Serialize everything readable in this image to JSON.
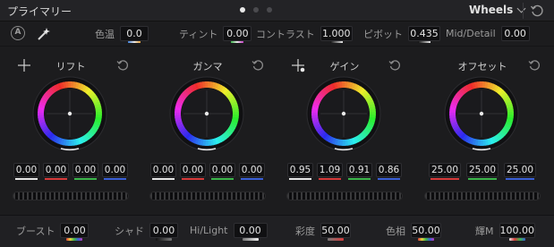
{
  "header": {
    "title": "プライマリー",
    "mode": "Wheels",
    "page_dots": 3,
    "active_dot": 0
  },
  "toolbar": {
    "auto_icon_letter": "A",
    "params": [
      {
        "label": "色温",
        "value": "0.0"
      },
      {
        "label": "ティント",
        "value": "0.00"
      },
      {
        "label": "コントラスト",
        "value": "1.000"
      },
      {
        "label": "ピボット",
        "value": "0.435"
      },
      {
        "label": "Mid/Detail",
        "value": "0.00"
      }
    ]
  },
  "wheels": [
    {
      "name": "リフト",
      "values": [
        "0.00",
        "0.00",
        "0.00",
        "0.00"
      ]
    },
    {
      "name": "ガンマ",
      "values": [
        "0.00",
        "0.00",
        "0.00",
        "0.00"
      ]
    },
    {
      "name": "ゲイン",
      "values": [
        "0.95",
        "1.09",
        "0.91",
        "0.86"
      ]
    },
    {
      "name": "オフセット",
      "values": [
        "25.00",
        "25.00",
        "25.00"
      ]
    }
  ],
  "footer": {
    "params": [
      {
        "label": "ブースト",
        "value": "0.00"
      },
      {
        "label": "シャド",
        "value": "0.00"
      },
      {
        "label": "Hi/Light",
        "value": "0.00"
      },
      {
        "label": "彩度",
        "value": "50.00"
      },
      {
        "label": "色相",
        "value": "50.00"
      },
      {
        "label": "輝M",
        "value": "100.00"
      }
    ]
  },
  "colors": {
    "red": "#d63a3a",
    "green": "#3bb54a",
    "blue": "#3a5fd6",
    "white": "#e6e6e6"
  }
}
